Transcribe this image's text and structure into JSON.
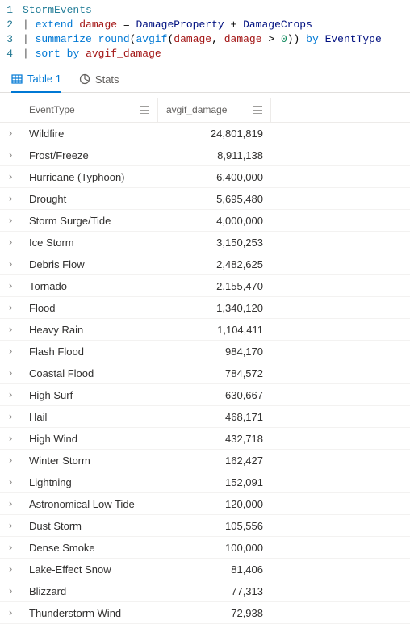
{
  "editor": {
    "lines": [
      {
        "num": "1",
        "tokens": [
          {
            "t": "StormEvents",
            "c": "tk-src"
          }
        ]
      },
      {
        "num": "2",
        "tokens": [
          {
            "t": "| ",
            "c": "tk-pipe"
          },
          {
            "t": "extend",
            "c": "tk-op"
          },
          {
            "t": " ",
            "c": "tk-plain"
          },
          {
            "t": "damage",
            "c": "tk-field"
          },
          {
            "t": " = ",
            "c": "tk-plain"
          },
          {
            "t": "DamageProperty",
            "c": "tk-ident"
          },
          {
            "t": " + ",
            "c": "tk-plain"
          },
          {
            "t": "DamageCrops",
            "c": "tk-ident"
          }
        ]
      },
      {
        "num": "3",
        "tokens": [
          {
            "t": "| ",
            "c": "tk-pipe"
          },
          {
            "t": "summarize",
            "c": "tk-op"
          },
          {
            "t": " ",
            "c": "tk-plain"
          },
          {
            "t": "round",
            "c": "tk-func"
          },
          {
            "t": "(",
            "c": "tk-plain"
          },
          {
            "t": "avgif",
            "c": "tk-func"
          },
          {
            "t": "(",
            "c": "tk-plain"
          },
          {
            "t": "damage",
            "c": "tk-field"
          },
          {
            "t": ", ",
            "c": "tk-plain"
          },
          {
            "t": "damage",
            "c": "tk-field"
          },
          {
            "t": " > ",
            "c": "tk-plain"
          },
          {
            "t": "0",
            "c": "tk-num"
          },
          {
            "t": ")) ",
            "c": "tk-plain"
          },
          {
            "t": "by",
            "c": "tk-by"
          },
          {
            "t": " ",
            "c": "tk-plain"
          },
          {
            "t": "EventType",
            "c": "tk-ident"
          }
        ]
      },
      {
        "num": "4",
        "tokens": [
          {
            "t": "| ",
            "c": "tk-pipe"
          },
          {
            "t": "sort",
            "c": "tk-op"
          },
          {
            "t": " ",
            "c": "tk-plain"
          },
          {
            "t": "by",
            "c": "tk-by"
          },
          {
            "t": " ",
            "c": "tk-plain"
          },
          {
            "t": "avgif_damage",
            "c": "tk-field"
          }
        ]
      }
    ]
  },
  "tabs": {
    "table_label": "Table 1",
    "stats_label": "Stats"
  },
  "columns": {
    "event_type": "EventType",
    "avgif_damage": "avgif_damage"
  },
  "rows": [
    {
      "type": "Wildfire",
      "dmg": "24,801,819"
    },
    {
      "type": "Frost/Freeze",
      "dmg": "8,911,138"
    },
    {
      "type": "Hurricane (Typhoon)",
      "dmg": "6,400,000"
    },
    {
      "type": "Drought",
      "dmg": "5,695,480"
    },
    {
      "type": "Storm Surge/Tide",
      "dmg": "4,000,000"
    },
    {
      "type": "Ice Storm",
      "dmg": "3,150,253"
    },
    {
      "type": "Debris Flow",
      "dmg": "2,482,625"
    },
    {
      "type": "Tornado",
      "dmg": "2,155,470"
    },
    {
      "type": "Flood",
      "dmg": "1,340,120"
    },
    {
      "type": "Heavy Rain",
      "dmg": "1,104,411"
    },
    {
      "type": "Flash Flood",
      "dmg": "984,170"
    },
    {
      "type": "Coastal Flood",
      "dmg": "784,572"
    },
    {
      "type": "High Surf",
      "dmg": "630,667"
    },
    {
      "type": "Hail",
      "dmg": "468,171"
    },
    {
      "type": "High Wind",
      "dmg": "432,718"
    },
    {
      "type": "Winter Storm",
      "dmg": "162,427"
    },
    {
      "type": "Lightning",
      "dmg": "152,091"
    },
    {
      "type": "Astronomical Low Tide",
      "dmg": "120,000"
    },
    {
      "type": "Dust Storm",
      "dmg": "105,556"
    },
    {
      "type": "Dense Smoke",
      "dmg": "100,000"
    },
    {
      "type": "Lake-Effect Snow",
      "dmg": "81,406"
    },
    {
      "type": "Blizzard",
      "dmg": "77,313"
    },
    {
      "type": "Thunderstorm Wind",
      "dmg": "72,938"
    }
  ]
}
